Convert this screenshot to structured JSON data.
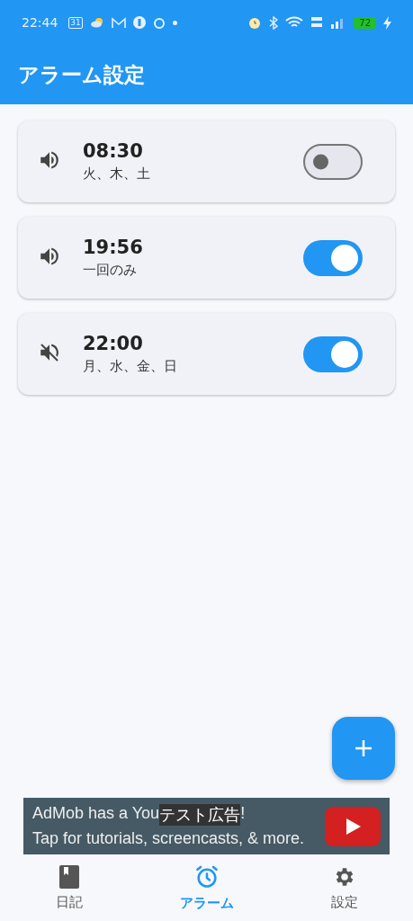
{
  "status_bar": {
    "time": "22:44",
    "calendar_day": "31",
    "battery": "72"
  },
  "header": {
    "title": "アラーム設定"
  },
  "alarms": [
    {
      "time": "08:30",
      "days": "火、木、土",
      "sound": true,
      "on": false
    },
    {
      "time": "19:56",
      "days": "一回のみ",
      "sound": true,
      "on": true
    },
    {
      "time": "22:00",
      "days": "月、水、金、日",
      "sound": false,
      "on": true
    }
  ],
  "ad": {
    "line1_start": "AdMob has a You",
    "test_label": "テスト広告",
    "line1_end": "!",
    "line2": "Tap for tutorials, screencasts, & more."
  },
  "nav": [
    {
      "label": "日記",
      "kind": "diary",
      "selected": false
    },
    {
      "label": "アラーム",
      "kind": "alarm",
      "selected": true
    },
    {
      "label": "設定",
      "kind": "settings",
      "selected": false
    }
  ]
}
